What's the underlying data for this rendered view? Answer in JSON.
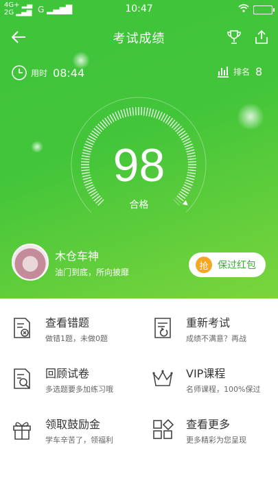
{
  "status": {
    "net1": "4G+",
    "net2": "2G",
    "carrier": "G",
    "time": "10:47"
  },
  "header": {
    "title": "考试成绩"
  },
  "stats": {
    "time_label": "用时",
    "time_value": "08:44",
    "rank_label": "排名",
    "rank_value": "8"
  },
  "result": {
    "score": "98",
    "status": "合格",
    "progress": 0.98
  },
  "user": {
    "name": "木仓车神",
    "motto": "油门到底，所向披靡"
  },
  "redpacket": {
    "badge": "抢",
    "label": "保过红包"
  },
  "menu": [
    {
      "title": "查看错题",
      "sub": "做错1题，未做0题",
      "icon": "wrong-questions-icon"
    },
    {
      "title": "重新考试",
      "sub": "成绩不满意？再战",
      "icon": "retake-exam-icon"
    },
    {
      "title": "回顾试卷",
      "sub": "多选题要多加练习哦",
      "icon": "review-paper-icon"
    },
    {
      "title": "VIP课程",
      "sub": "名师课程，100%保过",
      "icon": "crown-icon"
    },
    {
      "title": "领取鼓励金",
      "sub": "学车辛苦了，领福利",
      "icon": "gift-icon"
    },
    {
      "title": "查看更多",
      "sub": "更多精彩为您呈现",
      "icon": "grid-more-icon"
    }
  ]
}
